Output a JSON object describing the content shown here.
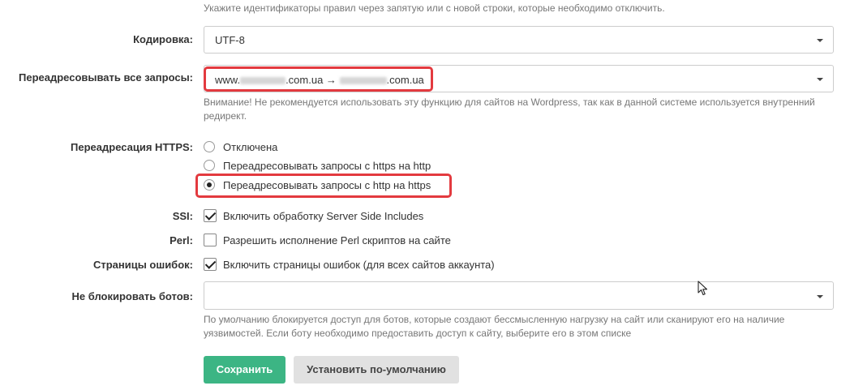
{
  "top_hint": "Укажите идентификаторы правил через запятую или с новой строки, которые необходимо отключить.",
  "encoding": {
    "label": "Кодировка:",
    "value": "UTF-8"
  },
  "redirect_all": {
    "label": "Переадресовывать все запросы:",
    "value_prefix": "www.",
    "value_mid": ".com.ua →",
    "value_suffix": ".com.ua",
    "warning": "Внимание! Не рекомендуется использовать эту функцию для сайтов на Wordpress, так как в данной системе используется внутренний редирект."
  },
  "https_redirect": {
    "label": "Переадресация HTTPS:",
    "options": [
      "Отключена",
      "Переадресовывать запросы с https на http",
      "Переадресовывать запросы с http на https"
    ],
    "selected_index": 2
  },
  "ssi": {
    "label": "SSI:",
    "text": "Включить обработку Server Side Includes",
    "checked": true
  },
  "perl": {
    "label": "Perl:",
    "text": "Разрешить исполнение Perl скриптов на сайте",
    "checked": false
  },
  "error_pages": {
    "label": "Страницы ошибок:",
    "text": "Включить страницы ошибок (для всех сайтов аккаунта)",
    "checked": true
  },
  "bots": {
    "label": "Не блокировать ботов:",
    "value": "",
    "hint": "По умолчанию блокируется доступ для ботов, которые создают бессмысленную нагрузку на сайт или сканируют его на наличие уязвимостей. Если боту необходимо предоставить доступ к сайту, выберите его в этом списке"
  },
  "buttons": {
    "save": "Сохранить",
    "default": "Установить по-умолчанию"
  },
  "colors": {
    "accent": "#3cb584",
    "highlight": "#e33a3f"
  }
}
